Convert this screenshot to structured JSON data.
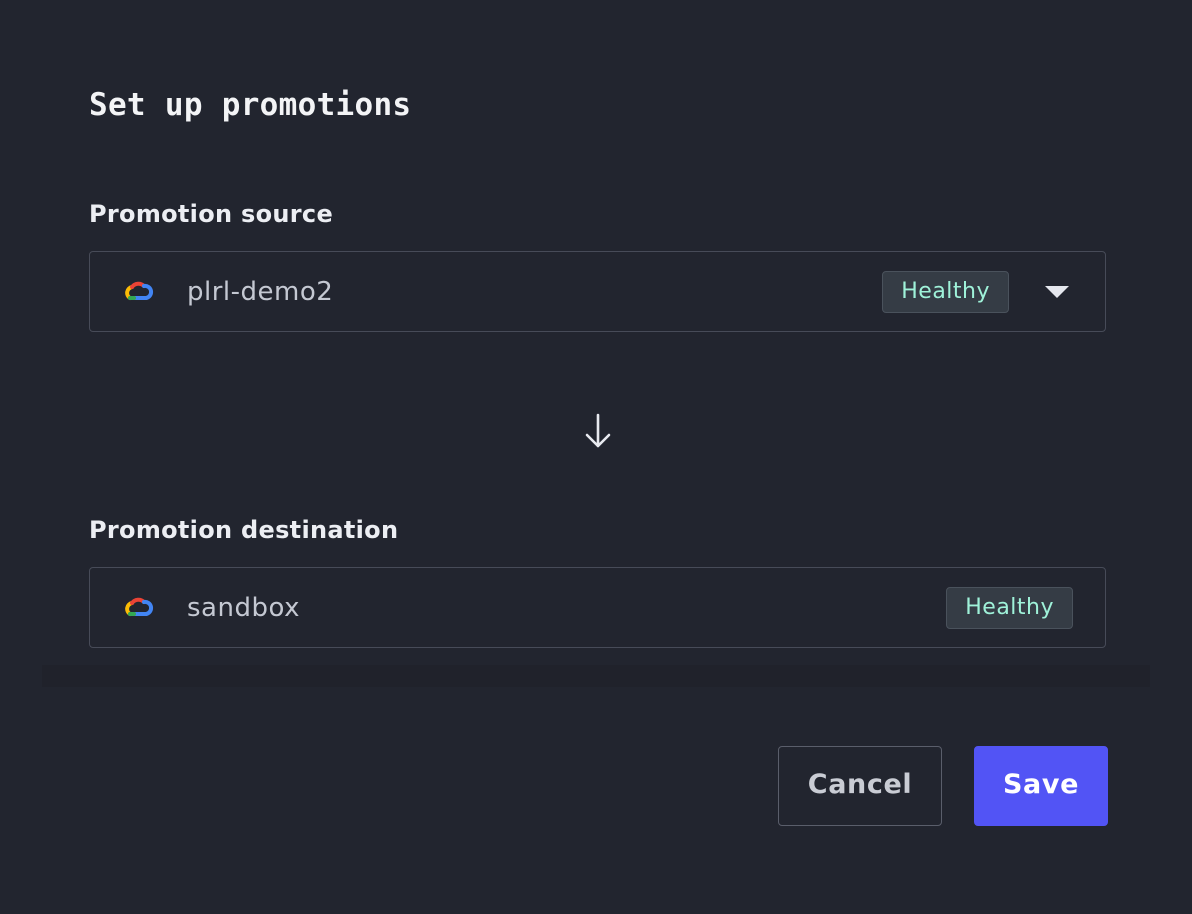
{
  "dialog": {
    "title": "Set up promotions"
  },
  "source": {
    "label": "Promotion source",
    "value": "plrl-demo2",
    "status": "Healthy",
    "icon": "gcp-cloud-icon"
  },
  "destination": {
    "label": "Promotion destination",
    "value": "sandbox",
    "status": "Healthy",
    "icon": "gcp-cloud-icon"
  },
  "actions": {
    "cancel_label": "Cancel",
    "save_label": "Save"
  },
  "colors": {
    "background": "#22252f",
    "primary": "#5254f5",
    "healthy_text": "#9ff2d9",
    "border": "#474b58"
  }
}
